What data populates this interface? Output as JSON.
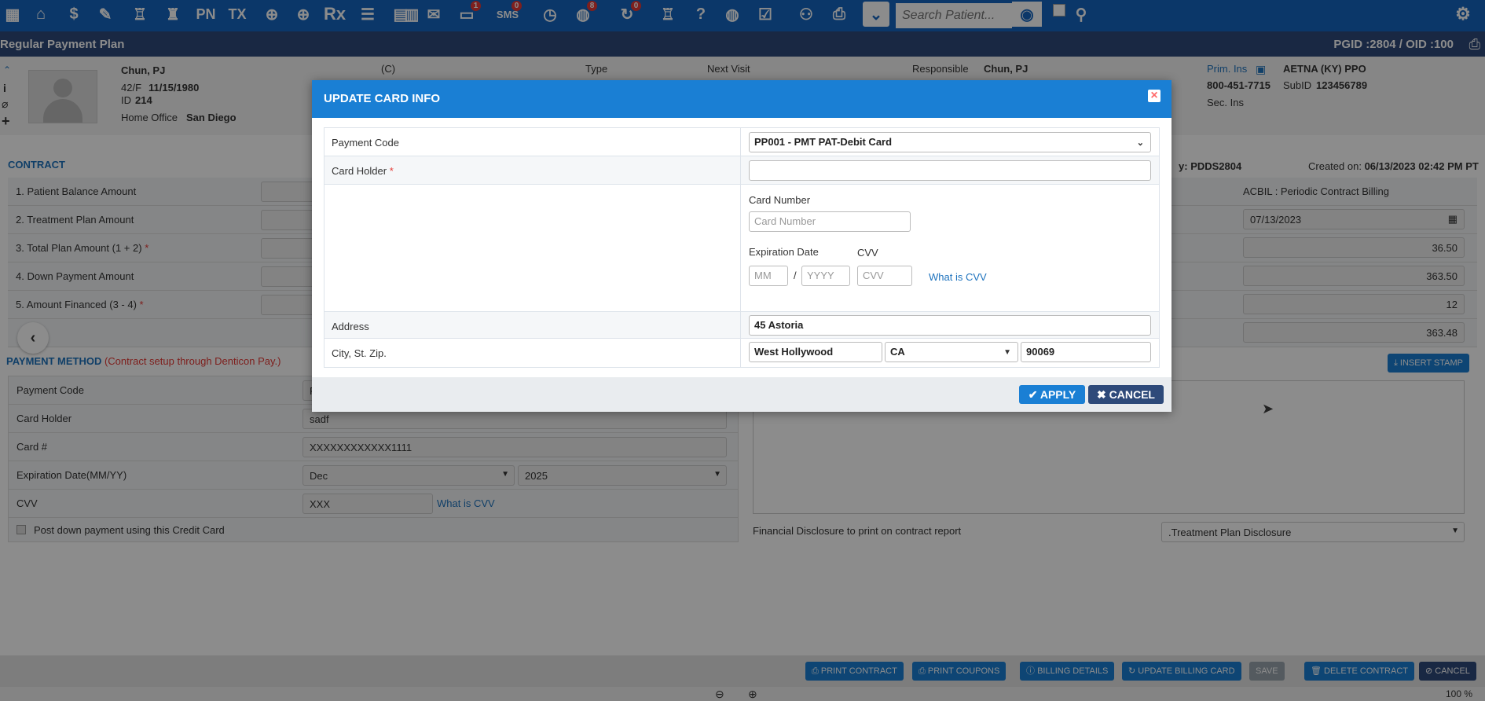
{
  "toolbar": {
    "icons": [
      "calendar-icon",
      "home-icon",
      "dollar-icon",
      "pencil-icon",
      "tooth-icon",
      "tooth-icon",
      "pn-icon",
      "tx-icon",
      "add-patient-icon",
      "add-patient-icon",
      "rx-icon",
      "list-icon",
      "document-icon",
      "document-icon",
      "mail-icon",
      "chat-icon",
      "sms-icon",
      "clock-icon",
      "globe-icon",
      "refresh-icon",
      "tooth-icon",
      "question-icon",
      "globe-icon",
      "checklist-icon",
      "family-icon",
      "printer-icon",
      "collapse-icon"
    ],
    "pn_label": "PN",
    "tx_label": "TX",
    "rx_label": "Rx",
    "sms_label": "SMS",
    "chat_badge": "1",
    "sms_badge": "0",
    "globe_badge": "8",
    "refresh_badge": "0",
    "search_placeholder": "Search Patient..."
  },
  "titlebar": {
    "title": "Regular Payment Plan",
    "ids": "PGID :2804  /  OID :100"
  },
  "patient": {
    "name": "Chun, PJ",
    "age_sex": "42/F",
    "dob": "11/15/1980",
    "id_label": "ID",
    "id": "214",
    "office_label": "Home Office",
    "office": "San Diego",
    "c_label": "(C)",
    "type_label": "Type",
    "next_visit_label": "Next Visit",
    "responsible_label": "Responsible",
    "responsible": "Chun, PJ",
    "prim_ins_label": "Prim. Ins",
    "prim_ins": "AETNA (KY) PPO",
    "phone": "800-451-7715",
    "subid_label": "SubID",
    "subid": "123456789",
    "sec_ins_label": "Sec. Ins"
  },
  "contract": {
    "section_title": "CONTRACT",
    "rows": [
      {
        "label": "1.  Patient Balance Amount",
        "req": ""
      },
      {
        "label": "2. Treatment Plan Amount",
        "req": ""
      },
      {
        "label": "3. Total Plan Amount (1 + 2)",
        "req": "*"
      },
      {
        "label": "4. Down Payment Amount",
        "req": ""
      },
      {
        "label": "5. Amount Financed (3 - 4)",
        "req": "*"
      }
    ],
    "by_label": "y:",
    "by_value": "PDDS2804",
    "created_label": "Created on:",
    "created_value": "06/13/2023 02:42 PM PT",
    "billing_type": "ACBIL : Periodic Contract Billing",
    "first_date": "07/13/2023",
    "right_values": [
      "36.50",
      "363.50",
      "12",
      "363.48"
    ]
  },
  "payment_method": {
    "title": "PAYMENT METHOD",
    "note": "(Contract setup through Denticon Pay.)",
    "rows": [
      {
        "label": "Payment Code",
        "value": "P"
      },
      {
        "label": "Card Holder",
        "value": "sadf"
      },
      {
        "label": "Card #",
        "value": "XXXXXXXXXXXX1111"
      },
      {
        "label": "Expiration Date(MM/YY)",
        "value": ""
      },
      {
        "label": "CVV",
        "value": "XXX"
      }
    ],
    "exp_month": "Dec",
    "exp_year": "2025",
    "what_is_cvv": "What is CVV",
    "post_down": "Post down payment using this Credit Card",
    "insert_stamp": "INSERT STAMP",
    "disclosure_label": "Financial Disclosure to print on contract report",
    "disclosure_value": ".Treatment Plan Disclosure"
  },
  "modal": {
    "title": "UPDATE CARD INFO",
    "payment_code_label": "Payment Code",
    "payment_code_value": "PP001 - PMT PAT-Debit Card",
    "card_holder_label": "Card Holder",
    "card_holder_req": "*",
    "card_holder_value": "",
    "card_number_label": "Card Number",
    "card_number_placeholder": "Card Number",
    "expiration_label": "Expiration Date",
    "cvv_label": "CVV",
    "mm_placeholder": "MM",
    "slash": "/",
    "yyyy_placeholder": "YYYY",
    "cvv_placeholder": "CVV",
    "what_is_cvv": "What is CVV",
    "address_label": "Address",
    "address_value": "45 Astoria",
    "city_label": "City, St. Zip.",
    "city_value": "West Hollywood",
    "state_value": "CA",
    "zip_value": "90069",
    "apply_label": "APPLY",
    "cancel_label": "CANCEL"
  },
  "bottom": {
    "buttons": [
      "PRINT CONTRACT",
      "PRINT COUPONS",
      "BILLING DETAILS",
      "UPDATE BILLING CARD",
      "SAVE",
      "DELETE CONTRACT",
      "CANCEL"
    ],
    "zoom": "100 %"
  },
  "colors": {
    "toolbar": "#1565c0",
    "titlebar": "#2e4a7a",
    "modal_header": "#1a7fd4",
    "accent_link": "#1e73be",
    "required": "#e53935"
  }
}
